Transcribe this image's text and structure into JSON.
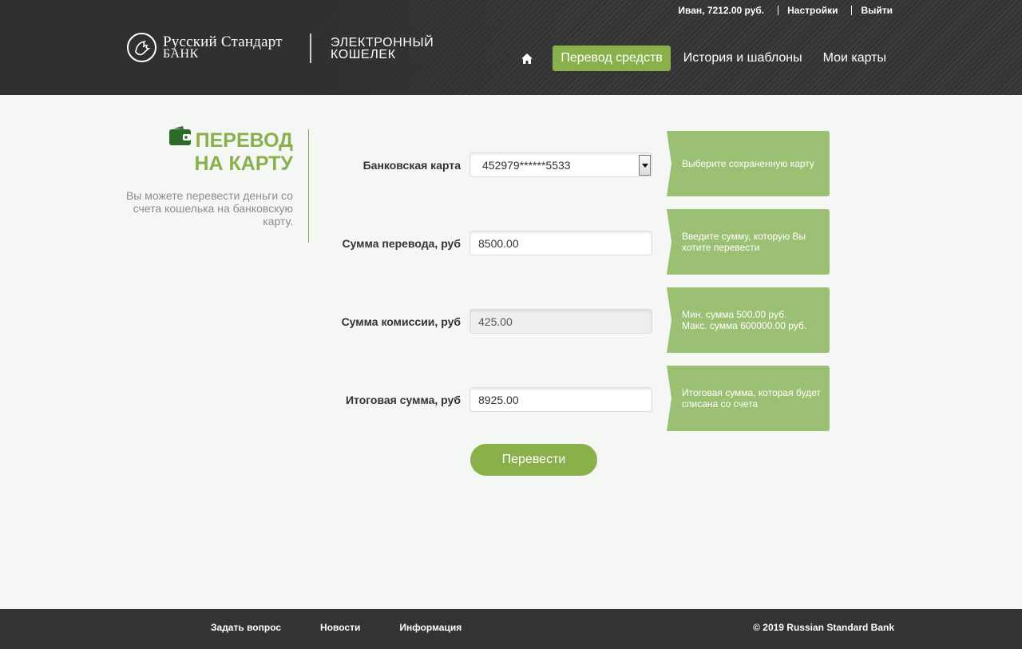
{
  "header": {
    "user_info": "Иван, 7212.00 руб.",
    "settings_label": "Настройки",
    "logout_label": "Выйти",
    "logo_line1": "Русский Стандарт",
    "logo_line2": "БАНК",
    "wallet_line1": "ЭЛЕКТРОННЫЙ",
    "wallet_line2": "КОШЕЛЕК",
    "nav": {
      "home_icon": "home-icon",
      "transfer": "Перевод средств",
      "history": "История и шаблоны",
      "cards": "Мои карты"
    }
  },
  "sidebar": {
    "title_line1": "ПЕРЕВОД",
    "title_line2": "НА КАРТУ",
    "description": "Вы можете перевести деньги со счета кошелька на банковскую карту.",
    "icon": "wallet-icon"
  },
  "form": {
    "card": {
      "label": "Банковская карта",
      "value": "452979******5533",
      "hint": "Выберите сохраненную карту"
    },
    "amount": {
      "label": "Сумма перевода, руб",
      "value": "8500.00",
      "hint": "Введите сумму, которую Вы хотите перевести"
    },
    "commission": {
      "label": "Сумма комиссии, руб",
      "value": "425.00",
      "hint_line1": "Мин. сумма 500.00 руб.",
      "hint_line2": "Макс. сумма 600000.00 руб."
    },
    "total": {
      "label": "Итоговая сумма, руб",
      "value": "8925.00",
      "hint": "Итоговая сумма, которая будет списана со счета"
    },
    "submit_label": "Перевести"
  },
  "footer": {
    "ask": "Задать вопрос",
    "news": "Новости",
    "info": "Информация",
    "copyright": "© 2019 Russian Standard Bank"
  },
  "colors": {
    "accent": "#8ab04c",
    "hint_bg": "#9cc073",
    "header_bg": "#333333"
  }
}
